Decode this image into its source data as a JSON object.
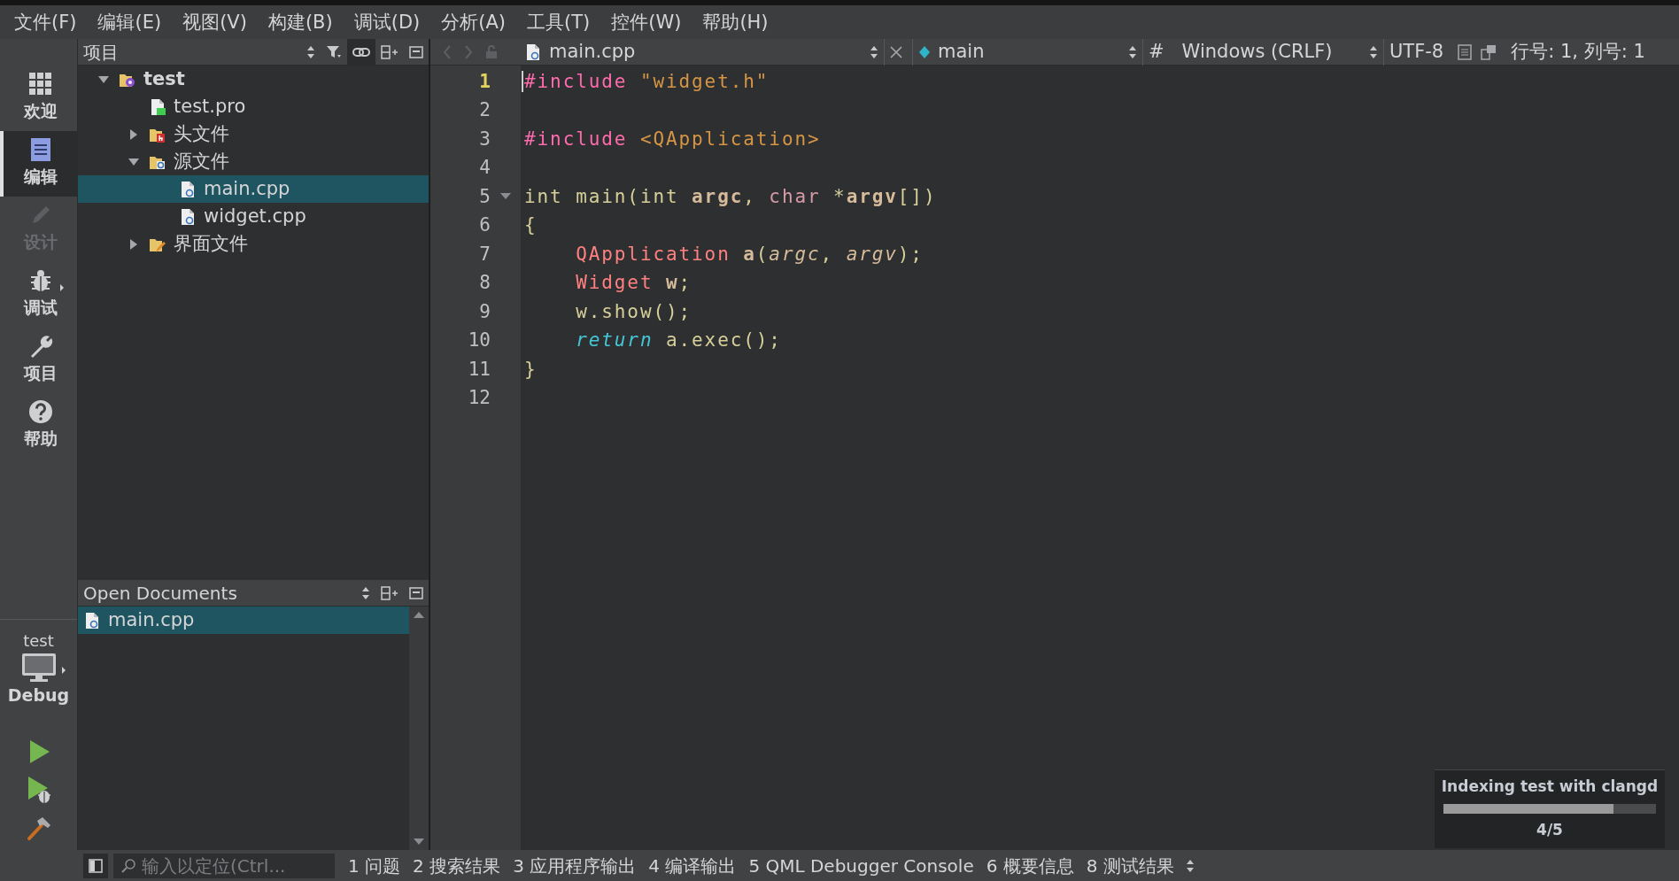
{
  "menu": [
    {
      "label": "文件(F)"
    },
    {
      "label": "编辑(E)"
    },
    {
      "label": "视图(V)"
    },
    {
      "label": "构建(B)"
    },
    {
      "label": "调试(D)"
    },
    {
      "label": "分析(A)"
    },
    {
      "label": "工具(T)"
    },
    {
      "label": "控件(W)"
    },
    {
      "label": "帮助(H)"
    }
  ],
  "mode_bar": {
    "modes": [
      {
        "label": "欢迎",
        "kind": "grid",
        "selected": false,
        "disabled": false,
        "menu": false
      },
      {
        "label": "编辑",
        "kind": "edit",
        "selected": true,
        "disabled": false,
        "menu": false
      },
      {
        "label": "设计",
        "kind": "design",
        "selected": false,
        "disabled": true,
        "menu": false
      },
      {
        "label": "调试",
        "kind": "debug",
        "selected": false,
        "disabled": false,
        "menu": true
      },
      {
        "label": "项目",
        "kind": "project",
        "selected": false,
        "disabled": false,
        "menu": false
      },
      {
        "label": "帮助",
        "kind": "help",
        "selected": false,
        "disabled": false,
        "menu": false
      }
    ],
    "kit": {
      "project": "test",
      "build": "Debug"
    },
    "actions": [
      {
        "kind": "run"
      },
      {
        "kind": "debug-run"
      },
      {
        "kind": "build"
      }
    ]
  },
  "project_pane": {
    "title": "项目",
    "tree": [
      {
        "label": "test",
        "kind": "project",
        "expanded": true,
        "selected": false,
        "children": [
          {
            "label": "test.pro",
            "kind": "pro",
            "selected": false
          },
          {
            "label": "头文件",
            "kind": "header-folder",
            "expanded": false,
            "selected": false
          },
          {
            "label": "源文件",
            "kind": "source-folder",
            "expanded": true,
            "selected": false,
            "children": [
              {
                "label": "main.cpp",
                "kind": "cpp",
                "selected": true
              },
              {
                "label": "widget.cpp",
                "kind": "cpp",
                "selected": false
              }
            ]
          },
          {
            "label": "界面文件",
            "kind": "form-folder",
            "expanded": false,
            "selected": false
          }
        ]
      }
    ]
  },
  "open_documents": {
    "title": "Open Documents",
    "items": [
      {
        "label": "main.cpp",
        "selected": true
      }
    ]
  },
  "editor": {
    "toolbar": {
      "file": "main.cpp",
      "symbol": "main",
      "hash": "#",
      "line_ending": "Windows (CRLF)",
      "encoding": "UTF-8",
      "position": "行号: 1, 列号: 1"
    },
    "lines": [
      {
        "number": "1",
        "current": true,
        "tokens": [
          {
            "text": "#include",
            "kind": "preproc"
          },
          {
            "text": " \"widget.h\"",
            "kind": "string"
          }
        ]
      },
      {
        "number": "2",
        "current": false
      },
      {
        "number": "3",
        "current": false,
        "tokens": [
          {
            "text": "#include",
            "kind": "preproc"
          },
          {
            "text": " <QApplication>",
            "kind": "string"
          }
        ]
      },
      {
        "number": "4",
        "current": false
      },
      {
        "number": "5",
        "current": false,
        "fold": true,
        "tokens": [
          {
            "text": "int main(int ",
            "kind": "plain"
          },
          {
            "text": "argc",
            "kind": "bold"
          },
          {
            "text": ", ",
            "kind": "plain"
          },
          {
            "text": "char",
            "kind": "primitive"
          },
          {
            "text": " *",
            "kind": "plain"
          },
          {
            "text": "argv",
            "kind": "bold"
          },
          {
            "text": "[])",
            "kind": "plain"
          }
        ]
      },
      {
        "number": "6",
        "current": false,
        "tokens": [
          {
            "text": "{",
            "kind": "plain"
          }
        ]
      },
      {
        "number": "7",
        "current": false,
        "tokens": [
          {
            "text": "    QApplication",
            "kind": "type"
          },
          {
            "text": " a",
            "kind": "bold"
          },
          {
            "text": "(",
            "kind": "plain"
          },
          {
            "text": "argc",
            "kind": "param"
          },
          {
            "text": ", ",
            "kind": "plain"
          },
          {
            "text": "argv",
            "kind": "param"
          },
          {
            "text": ");",
            "kind": "plain"
          }
        ]
      },
      {
        "number": "8",
        "current": false,
        "tokens": [
          {
            "text": "    Widget",
            "kind": "type"
          },
          {
            "text": " w",
            "kind": "bold"
          },
          {
            "text": ";",
            "kind": "plain"
          }
        ]
      },
      {
        "number": "9",
        "current": false,
        "tokens": [
          {
            "text": "    w.show();",
            "kind": "plain"
          }
        ]
      },
      {
        "number": "10",
        "current": false,
        "tokens": [
          {
            "text": "    return",
            "kind": "keyword"
          },
          {
            "text": " a.exec();",
            "kind": "plain"
          }
        ]
      },
      {
        "number": "11",
        "current": false,
        "tokens": [
          {
            "text": "}",
            "kind": "plain"
          }
        ]
      },
      {
        "number": "12",
        "current": false
      }
    ]
  },
  "indexing": {
    "title": "Indexing test with clangd",
    "level": 0.8,
    "progress": "4/5"
  },
  "status_bar": {
    "locator_placeholder": "输入以定位(Ctrl...",
    "panes": [
      {
        "label": "1 问题"
      },
      {
        "label": "2 搜索结果"
      },
      {
        "label": "3 应用程序输出"
      },
      {
        "label": "4 编译输出"
      },
      {
        "label": "5 QML Debugger Console"
      },
      {
        "label": "6 概要信息"
      },
      {
        "label": "8 测试结果"
      }
    ]
  }
}
